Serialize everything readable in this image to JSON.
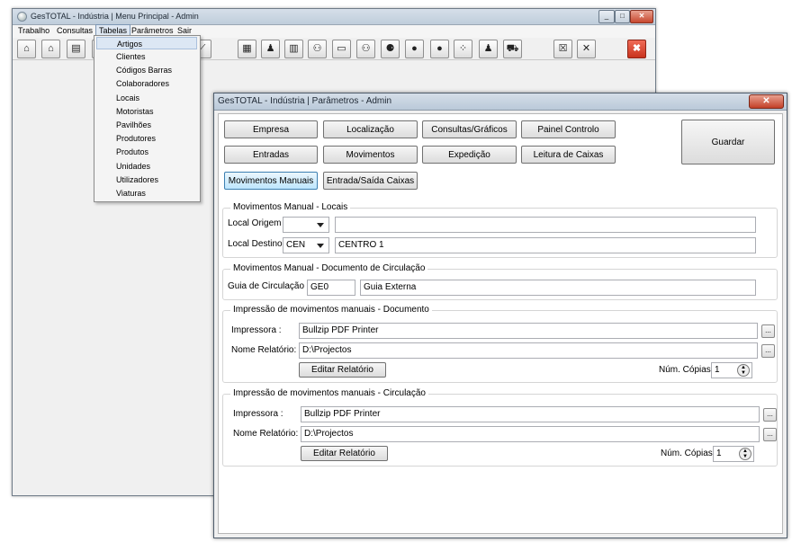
{
  "main_window": {
    "title": "GesTOTAL - Indústria | Menu Principal - Admin",
    "caption_buttons": {
      "minimize": "_",
      "maximize": "□",
      "close": "✕"
    },
    "menu": [
      "Trabalho",
      "Consultas",
      "Tabelas",
      "Parâmetros",
      "Sair"
    ],
    "toolbar_icons": [
      "home-icon",
      "home-alt-icon",
      "document-icon",
      "ruler-icon",
      "tools-icon",
      "equipment-icon",
      "person-icon",
      "book-icon",
      "group-icon",
      "factory-icon",
      "team-icon",
      "users-grid-icon",
      "apple-icon",
      "fruits-icon",
      "dots-icon",
      "worker-icon",
      "truck-icon",
      "x-box-icon",
      "wrench-icon",
      "exit-icon"
    ],
    "toolbar_glyphs": [
      "⌂",
      "⌂",
      "▤",
      "⟋",
      "⟋",
      "▦",
      "♟",
      "▥",
      "⚇",
      "▭",
      "⚇",
      "⚈",
      "●",
      "●",
      "⁘",
      "♟",
      "⛟",
      "☒",
      "✕",
      "✖"
    ]
  },
  "tabelas_menu": {
    "items": [
      "Artigos",
      "Clientes",
      "Códigos Barras",
      "Colaboradores",
      "Locais",
      "Motoristas",
      "Pavilhões",
      "Produtores",
      "Produtos",
      "Unidades",
      "Utilizadores",
      "Viaturas"
    ],
    "highlighted": "Artigos"
  },
  "params_window": {
    "title": "GesTOTAL - Indústria | Parâmetros - Admin",
    "close_glyph": "✕",
    "buttons_row1": [
      "Empresa",
      "Localização",
      "Consultas/Gráficos",
      "Painel Controlo"
    ],
    "buttons_row2": [
      "Entradas",
      "Movimentos",
      "Expedição",
      "Leitura de Caixas"
    ],
    "buttons_row3": [
      "Movimentos Manuais",
      "Entrada/Saída Caixas"
    ],
    "save_label": "Guardar",
    "group_locais": {
      "title": "Movimentos Manual - Locais",
      "origem_label": "Local Origem :",
      "origem_code": "",
      "origem_name": "",
      "destino_label": "Local Destino :",
      "destino_code": "CEN",
      "destino_name": "CENTRO 1"
    },
    "group_documento": {
      "title": "Movimentos Manual - Documento de Circulação",
      "guia_label": "Guia de Circulação :",
      "guia_code": "GE0",
      "guia_name": "Guia Externa"
    },
    "group_print_doc": {
      "title": "Impressão de movimentos manuais - Documento",
      "printer_label": "Impressora :",
      "printer_value": "Bullzip PDF Printer",
      "report_label": "Nome Relatório:",
      "report_value": "D:\\Projectos",
      "edit_button": "Editar Relatório",
      "copies_label": "Núm. Cópias:",
      "copies_value": "1",
      "ellipsis": "..."
    },
    "group_print_circ": {
      "title": "Impressão de movimentos manuais - Circulação",
      "printer_label": "Impressora :",
      "printer_value": "Bullzip PDF Printer",
      "report_label": "Nome Relatório:",
      "report_value": "D:\\Projectos",
      "edit_button": "Editar Relatório",
      "copies_label": "Núm. Cópias:",
      "copies_value": "1",
      "ellipsis": "..."
    }
  }
}
